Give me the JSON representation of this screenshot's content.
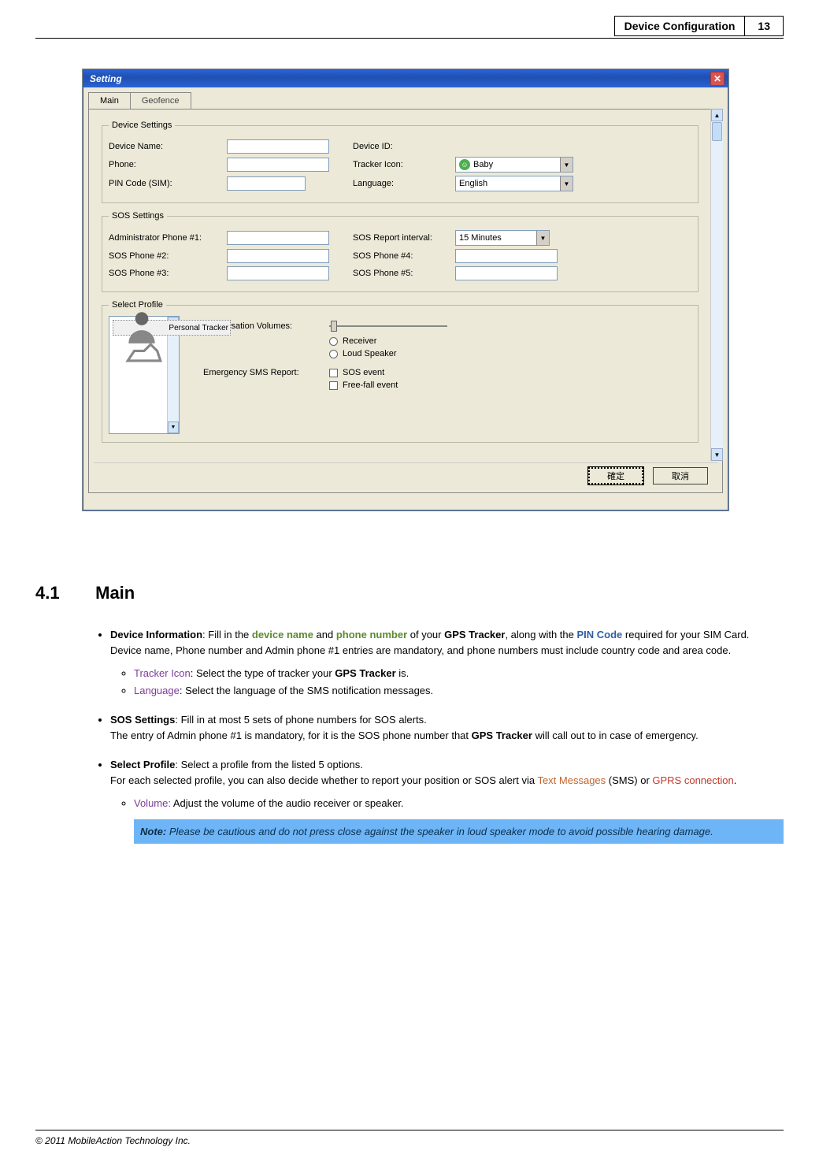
{
  "header": {
    "title": "Device Configuration",
    "page": "13"
  },
  "dialog": {
    "title": "Setting",
    "tabs": {
      "main": "Main",
      "geofence": "Geofence"
    },
    "fs_device": {
      "legend": "Device Settings",
      "device_name": "Device Name:",
      "phone": "Phone:",
      "pin": "PIN Code (SIM):",
      "device_id": "Device ID:",
      "tracker_icon": "Tracker Icon:",
      "tracker_val": "Baby",
      "language": "Language:",
      "language_val": "English"
    },
    "fs_sos": {
      "legend": "SOS Settings",
      "admin1": "Administrator Phone #1:",
      "sos2": "SOS Phone #2:",
      "sos3": "SOS Phone #3:",
      "interval": "SOS Report interval:",
      "interval_val": "15 Minutes",
      "sos4": "SOS Phone #4:",
      "sos5": "SOS Phone #5:"
    },
    "fs_profile": {
      "legend": "Select Profile",
      "item1": "Personal Tracker",
      "conv_vol": "Conversation Volumes:",
      "receiver": "Receiver",
      "loud": "Loud Speaker",
      "emerg": "Emergency SMS Report:",
      "sos_ev": "SOS event",
      "ff_ev": "Free-fall event"
    },
    "buttons": {
      "ok": "確定",
      "cancel": "取消"
    }
  },
  "section": {
    "heading_num": "4.1",
    "heading_txt": "Main",
    "b1_strong": "Device Information",
    "b1_t1": ": Fill in the ",
    "b1_dn": "device name",
    "b1_t2": " and ",
    "b1_pn": "phone number",
    "b1_t3": " of your ",
    "b1_gps": "GPS Tracker",
    "b1_t4": ", along with the ",
    "b1_pin": "PIN Code",
    "b1_t5": " required for your SIM Card.",
    "b1_line2": "Device name, Phone number and Admin phone #1 entries are mandatory, and phone numbers must include country code and area code.",
    "s1a_lbl": "Tracker Icon",
    "s1a_txt1": ": Select the type of tracker your ",
    "s1a_gps": "GPS Tracker",
    "s1a_txt2": " is.",
    "s1b_lbl": "Language",
    "s1b_txt": ": Select the language of the SMS notification messages.",
    "b2_strong": "SOS Settings",
    "b2_t1": ": Fill in at most 5 sets of phone numbers for SOS alerts.",
    "b2_line2a": "The entry of Admin phone #1 is mandatory, for it is the SOS phone number that ",
    "b2_gps": "GPS Tracker",
    "b2_line2b": " will call out to in case of emergency.",
    "b3_strong": "Select Profile",
    "b3_t1": ": Select a profile from the listed 5 options.",
    "b3_line2a": "For each selected profile, you can also decide whether to report your position or SOS alert via ",
    "b3_tm": "Text Messages",
    "b3_line2b": " (SMS) or ",
    "b3_gprs": "GPRS connection",
    "b3_line2c": ".",
    "s3a_lbl": "Volume:",
    "s3a_txt": " Adjust the volume of the audio receiver or speaker.",
    "note_strong": "Note:",
    "note_txt": " Please be cautious and do not press close against the speaker in loud speaker mode to avoid possible hearing damage."
  },
  "footer": "© 2011 MobileAction Technology Inc."
}
